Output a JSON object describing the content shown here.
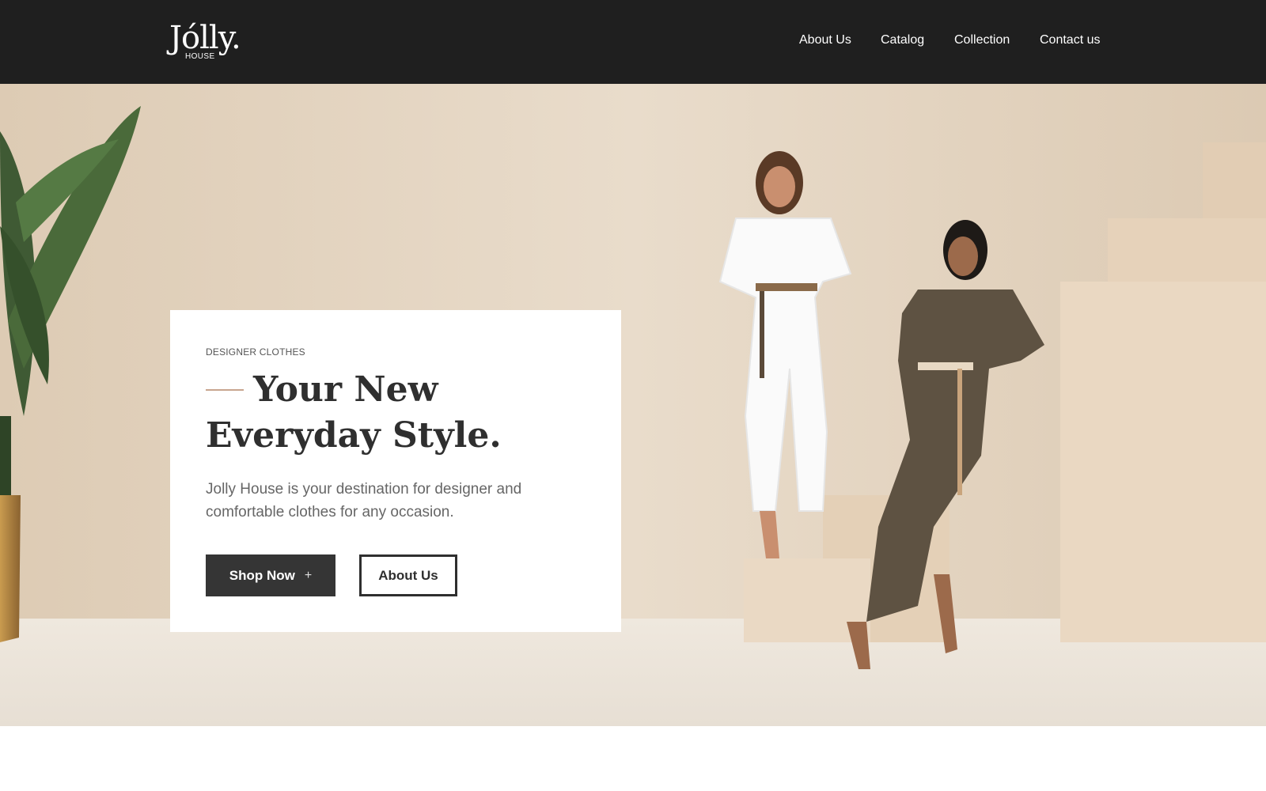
{
  "header": {
    "logo_word": "Jólly.",
    "logo_sub": "HOUSE",
    "nav": [
      "About Us",
      "Catalog",
      "Collection",
      "Contact us"
    ]
  },
  "hero": {
    "eyebrow": "DESIGNER CLOTHES",
    "headline_line1": "Your New",
    "headline_line2": "Everyday Style.",
    "lead": "Jolly House is your destination for designer and comfortable clothes for any occasion.",
    "shop_label": "Shop Now",
    "shop_icon": "plus-icon",
    "about_label": "About Us"
  },
  "colors": {
    "topbar": "#1f1f1f",
    "hero_wall": "#e5d6c4",
    "accent_dash": "#c8a58f",
    "button_dark": "#353535"
  }
}
